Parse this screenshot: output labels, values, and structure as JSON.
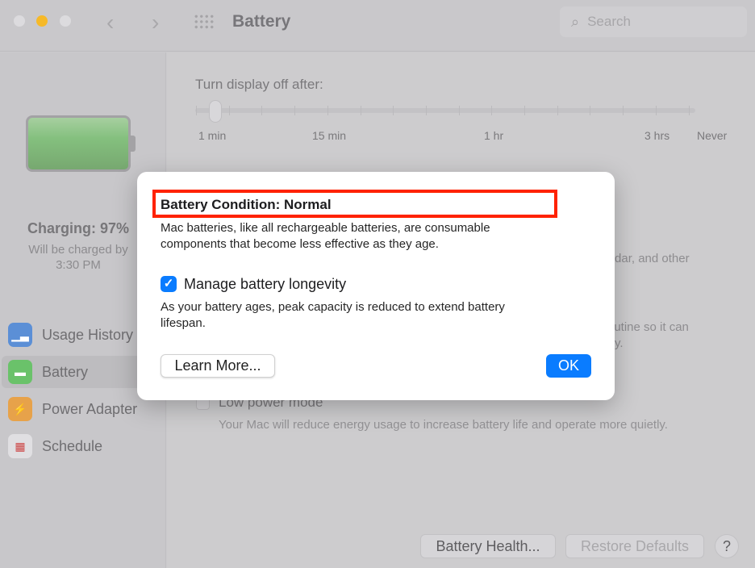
{
  "window": {
    "title": "Battery",
    "search_placeholder": "Search"
  },
  "sidebar": {
    "battery_status": "Charging: 97%",
    "charge_note_line1": "Will be charged by",
    "charge_note_line2": "3:30 PM",
    "items": [
      {
        "label": "Usage History",
        "icon": "bar-chart-icon",
        "color": "#5b8fd6"
      },
      {
        "label": "Battery",
        "icon": "battery-icon",
        "color": "#6ac26a",
        "selected": true
      },
      {
        "label": "Power Adapter",
        "icon": "lightning-icon",
        "color": "#e7a24a"
      },
      {
        "label": "Schedule",
        "icon": "calendar-icon",
        "color": "#e0dfe2"
      }
    ]
  },
  "main": {
    "display_off_label": "Turn display off after:",
    "slider_labels": [
      "1 min",
      "15 min",
      "1 hr",
      "3 hrs",
      "Never"
    ],
    "slider_value": "1 min",
    "fragment1": "lendar, and other",
    "fragment2": "routine so it can",
    "fragment3": "y.",
    "low_power_label": "Low power mode",
    "low_power_desc": "Your Mac will reduce energy usage to increase battery life and operate more quietly.",
    "battery_health_button": "Battery Health...",
    "restore_defaults_button": "Restore Defaults",
    "help_button": "?"
  },
  "dialog": {
    "title": "Battery Condition: Normal",
    "description": "Mac batteries, like all rechargeable batteries, are consumable components that become less effective as they age.",
    "checkbox_label": "Manage battery longevity",
    "checkbox_checked": true,
    "checkbox_desc": "As your battery ages, peak capacity is reduced to extend battery lifespan.",
    "learn_more": "Learn More...",
    "ok": "OK",
    "highlight_color": "#ff2200",
    "accent": "#0a7cff"
  }
}
